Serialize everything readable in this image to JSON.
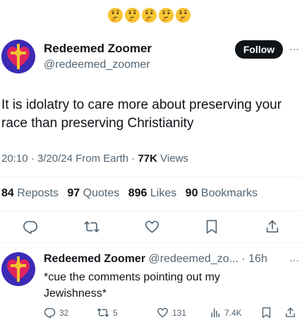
{
  "reaction_emojis": [
    "thinking-face-icon",
    "thinking-face-icon",
    "thinking-face-icon",
    "thinking-face-icon",
    "thinking-face-icon"
  ],
  "tweet": {
    "author_name": "Redeemed Zoomer",
    "author_handle": "@redeemed_zoomer",
    "follow_label": "Follow",
    "more_label": "···",
    "text": "It is idolatry to care more about preserving your race than preserving Christianity",
    "time": "20:10",
    "date": "3/20/24",
    "source": "From Earth",
    "views_count": "77K",
    "views_label": "Views",
    "sep": "·"
  },
  "stats": {
    "reposts_count": "84",
    "reposts_label": "Reposts",
    "quotes_count": "97",
    "quotes_label": "Quotes",
    "likes_count": "896",
    "likes_label": "Likes",
    "bookmarks_count": "90",
    "bookmarks_label": "Bookmarks"
  },
  "actions": [
    "reply-icon",
    "repost-icon",
    "like-icon",
    "bookmark-icon",
    "share-icon"
  ],
  "reply": {
    "author_name": "Redeemed Zoomer",
    "author_handle": "@redeemed_zo...",
    "sep": "·",
    "age": "16h",
    "more_label": "···",
    "text": "*cue the comments pointing out my Jewishness*",
    "replies": "32",
    "reposts": "5",
    "likes": "131",
    "views": "7.4K"
  },
  "colors": {
    "text": "#0f1419",
    "muted": "#536471",
    "divider": "#eff3f4",
    "follow_bg": "#0f1419",
    "avatar_bg": "#3b2bb5",
    "avatar_heart": "#e0245e",
    "cross": "#f4c430"
  }
}
